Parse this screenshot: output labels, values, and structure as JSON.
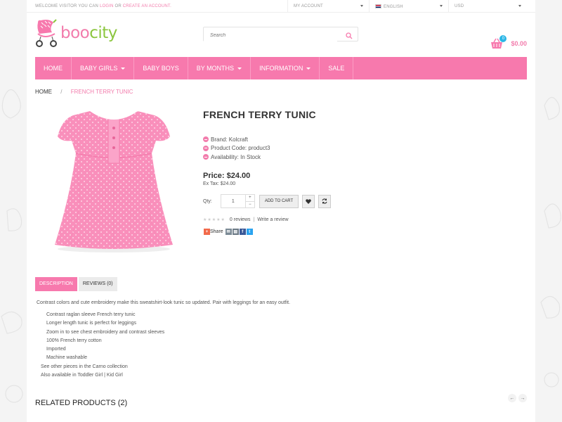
{
  "topbar": {
    "welcome_prefix": "WELCOME VISITOR YOU CAN",
    "login": "LOGIN",
    "or": "OR",
    "create_account": "CREATE AN ACCOUNT.",
    "my_account": "MY ACCOUNT",
    "language": "ENGLISH",
    "currency": "USD"
  },
  "header": {
    "logo_boo": "boo",
    "logo_city": "city",
    "search_placeholder": "Search",
    "cart_count": "0",
    "cart_total": "$0.00"
  },
  "nav": {
    "items": [
      {
        "label": "HOME"
      },
      {
        "label": "BABY GIRLS"
      },
      {
        "label": "BABY BOYS"
      },
      {
        "label": "BY MONTHS"
      },
      {
        "label": "INFORMATION"
      },
      {
        "label": "SALE"
      }
    ]
  },
  "breadcrumb": {
    "home": "HOME",
    "separator": "/",
    "current": "FRENCH TERRY TUNIC"
  },
  "product": {
    "title": "FRENCH TERRY TUNIC",
    "brand": "Brand: Kolcraft",
    "code": "Product Code: product3",
    "availability": "Availability: In Stock",
    "price": "Price: $24.00",
    "ex_tax": "Ex Tax: $24.00",
    "qty_label": "Qty:",
    "qty_value": "1",
    "add_to_cart": "ADD TO CART",
    "reviews": "0 reviews",
    "review_sep": "|",
    "write_review": "Write a review",
    "share": "Share",
    "rating": 0,
    "rating_max": 5
  },
  "tabs": {
    "description": "DESCRIPTION",
    "reviews": "REVIEWS (0)"
  },
  "description": {
    "intro": "Contrast colors and cute embroidery make this sweatshirt-look tunic so updated. Pair with leggings for an easy outfit.",
    "bullets": [
      "Contrast raglan sleeve French terry tunic",
      "Longer length tunic is perfect for leggings",
      "Zoom in to see chest embroidery and contrast sleeves",
      "100% French terry cotton",
      "Imported",
      "Machine washable"
    ],
    "extra1": "See other pieces in the Carno collection",
    "extra2": "Also available in Toddler Girl | Kid Girl"
  },
  "related": {
    "title": "RELATED PRODUCTS (2)",
    "prev": "←",
    "next": "→"
  },
  "colors": {
    "accent": "#f779ad",
    "logo_green": "#8cc63f",
    "badge_blue": "#2bb6e6"
  }
}
